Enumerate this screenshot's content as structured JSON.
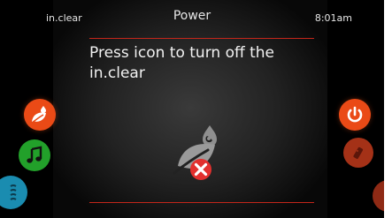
{
  "header": {
    "app_name": "in.clear",
    "title": "Power",
    "time": "8:01am"
  },
  "main": {
    "message": "Press icon to turn off the in.clear",
    "icon": "leaf-drop-off-icon"
  },
  "left_nav": [
    {
      "icon": "leaf-drop-icon",
      "color": "#ea4a16"
    },
    {
      "icon": "music-note-icon",
      "color": "#22a02a"
    },
    {
      "icon": "waves-icon",
      "color": "#1a8cb0"
    }
  ],
  "right_nav": [
    {
      "icon": "power-icon",
      "color": "#ea4a16"
    },
    {
      "icon": "remote-icon",
      "color": "#c13a1c"
    },
    {
      "icon": "partial-button",
      "color": "#b3341a"
    }
  ],
  "colors": {
    "accent_red": "#c4261a",
    "off_badge": "#e2302e"
  }
}
